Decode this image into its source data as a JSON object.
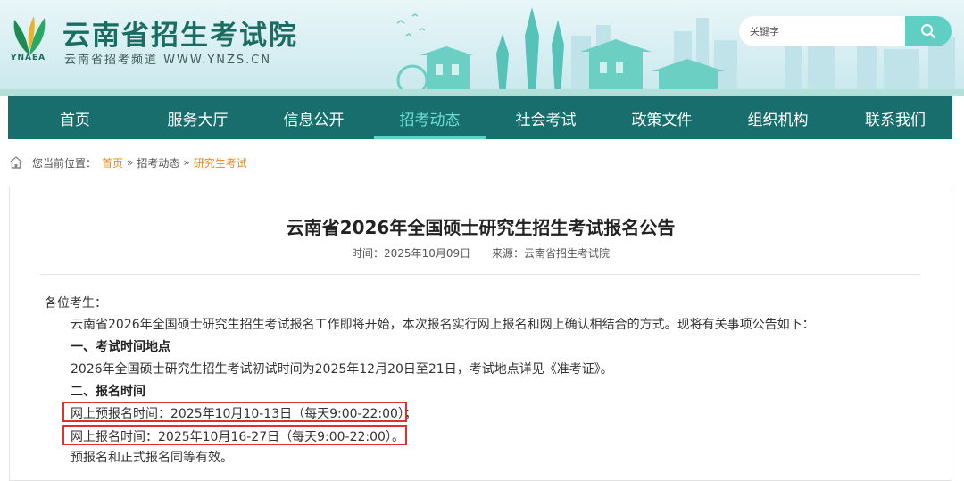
{
  "header": {
    "logo_abbr": "YNAEA",
    "site_title": "云南省招生考试院",
    "site_subtitle": "云南省招考频道 WWW.YNZS.CN",
    "search_placeholder": "关键字",
    "search_icon": "search-icon"
  },
  "nav": {
    "items": [
      {
        "label": "首页"
      },
      {
        "label": "服务大厅"
      },
      {
        "label": "信息公开"
      },
      {
        "label": "招考动态",
        "active": true
      },
      {
        "label": "社会考试"
      },
      {
        "label": "政策文件"
      },
      {
        "label": "组织机构"
      },
      {
        "label": "联系我们"
      }
    ],
    "active_color": "#6fe0d6",
    "bg_color": "#176e6c"
  },
  "breadcrumb": {
    "prefix": "您当前位置：",
    "home": "首页",
    "sep": "»",
    "section": "招考动态",
    "current": "研究生考试",
    "icon": "home-icon"
  },
  "article": {
    "title": "云南省2026年全国硕士研究生招生考试报名公告",
    "time": "时间：2025年10月09日",
    "source": "来源：云南省招生考试院",
    "greeting": "各位考生：",
    "intro": "云南省2026年全国硕士研究生招生考试报名工作即将开始，本次报名实行网上报名和网上确认相结合的方式。现将有关事项公告如下：",
    "section1_title": "一、考试时间地点",
    "section1_body": "2026年全国硕士研究生招生考试初试时间为2025年12月20日至21日，考试地点详见《准考证》。",
    "section2_title": "二、报名时间",
    "prereg": "网上预报名时间：2025年10月10-13日（每天9:00-22:00）；",
    "reg": "网上报名时间：2025年10月16-27日（每天9:00-22:00）。",
    "note": "预报名和正式报名同等有效。",
    "highlight_color": "#e0302d"
  }
}
